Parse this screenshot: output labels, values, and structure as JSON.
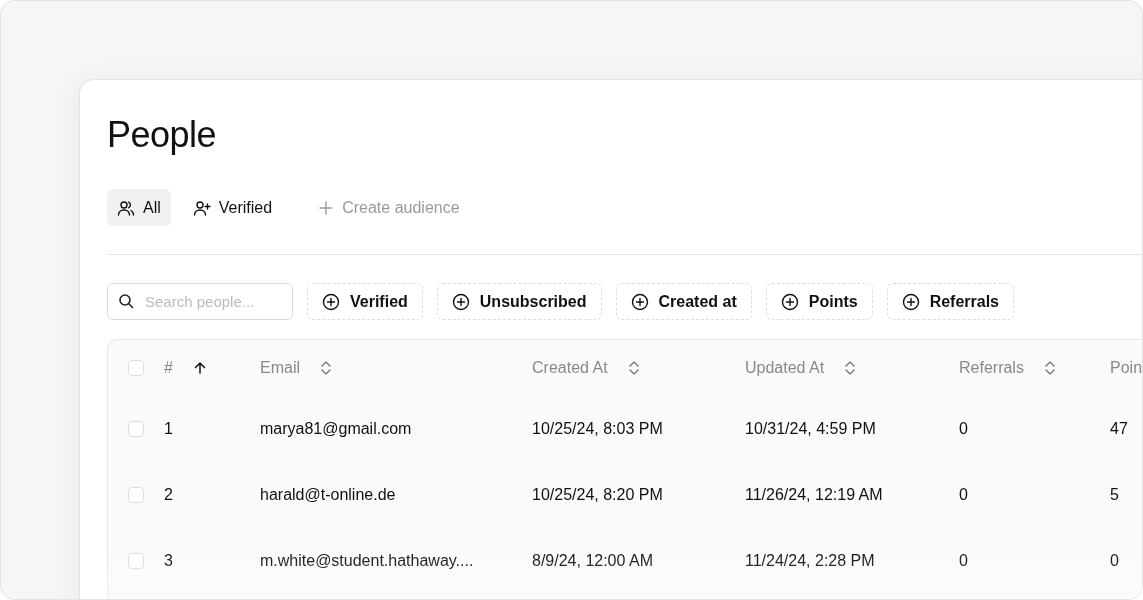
{
  "title": "People",
  "tabs": [
    {
      "label": "All",
      "kind": "group",
      "selected": true
    },
    {
      "label": "Verified",
      "kind": "verified",
      "selected": false
    },
    {
      "label": "Create audience",
      "kind": "create",
      "selected": false
    }
  ],
  "search": {
    "placeholder": "Search people..."
  },
  "filters": [
    "Verified",
    "Unsubscribed",
    "Created at",
    "Points",
    "Referrals"
  ],
  "table": {
    "select_all_checked": false,
    "columns": [
      {
        "label": "#",
        "sorted": true
      },
      {
        "label": "Email",
        "sorted": false
      },
      {
        "label": "Created At",
        "sorted": false
      },
      {
        "label": "Updated At",
        "sorted": false
      },
      {
        "label": "Referrals",
        "sorted": false
      },
      {
        "label": "Poin"
      }
    ],
    "rows": [
      {
        "checked": false,
        "cells": [
          "1",
          "marya81@gmail.com",
          "10/25/24, 8:03 PM",
          "10/31/24, 4:59 PM",
          "0",
          "47"
        ]
      },
      {
        "checked": false,
        "cells": [
          "2",
          "harald@t-online.de",
          "10/25/24, 8:20 PM",
          "11/26/24, 12:19 AM",
          "0",
          "5"
        ]
      },
      {
        "checked": false,
        "cells": [
          "3",
          "m.white@student.hathaway....",
          "8/9/24, 12:00 AM",
          "11/24/24, 2:28 PM",
          "0",
          "0"
        ]
      }
    ]
  }
}
